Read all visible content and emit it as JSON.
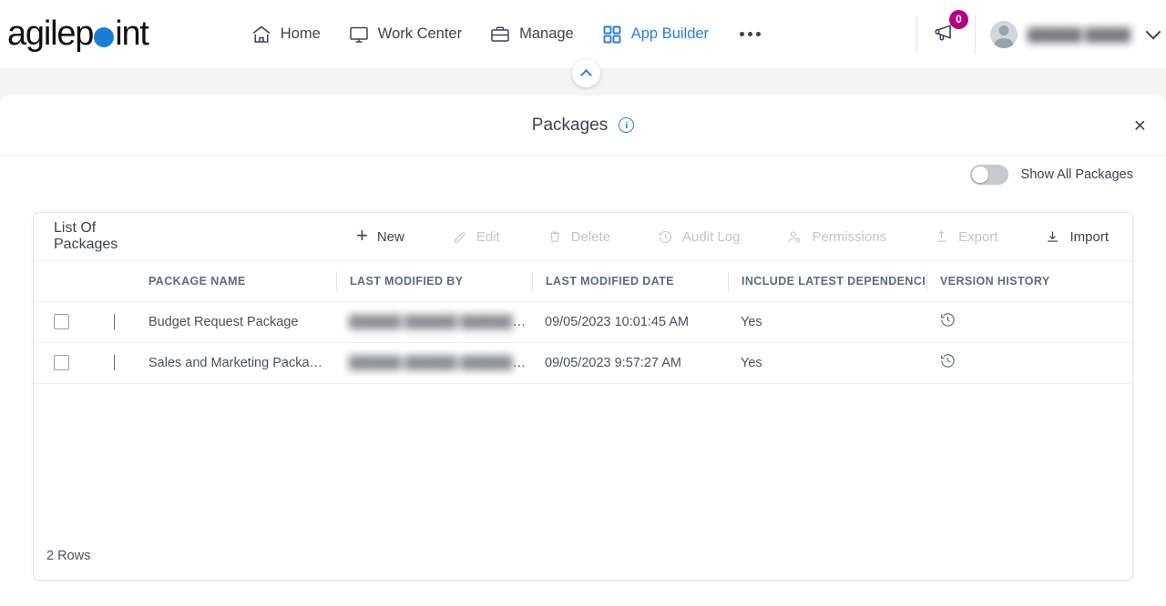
{
  "brand": {
    "name_part1": "agilep",
    "name_part2": "int",
    "dot_color": "#1a7fd4"
  },
  "topnav": {
    "items": [
      {
        "label": "Home",
        "icon": "home-icon",
        "active": false
      },
      {
        "label": "Work Center",
        "icon": "monitor-icon",
        "active": false
      },
      {
        "label": "Manage",
        "icon": "briefcase-icon",
        "active": false
      },
      {
        "label": "App Builder",
        "icon": "grid-icon",
        "active": true
      }
    ],
    "more_label": "",
    "announcement_badge": "0",
    "user_name": "██████ █████",
    "accent_color": "#2a7de1",
    "badge_color": "#b5007e"
  },
  "panel": {
    "title": "Packages",
    "info_icon": "info-icon",
    "close_label": "×",
    "collapse_icon": "chevron-up-icon"
  },
  "show_all": {
    "label": "Show All Packages",
    "checked": false
  },
  "card": {
    "heading": "List Of Packages",
    "toolbar": [
      {
        "label": "New",
        "icon": "plus-icon",
        "disabled": false
      },
      {
        "label": "Edit",
        "icon": "pencil-icon",
        "disabled": true
      },
      {
        "label": "Delete",
        "icon": "trash-icon",
        "disabled": true
      },
      {
        "label": "Audit Log",
        "icon": "history-icon",
        "disabled": true
      },
      {
        "label": "Permissions",
        "icon": "user-permissions-icon",
        "disabled": true
      },
      {
        "label": "Export",
        "icon": "upload-icon",
        "disabled": true
      },
      {
        "label": "Import",
        "icon": "download-icon",
        "disabled": false
      }
    ],
    "columns": [
      "PACKAGE NAME",
      "LAST MODIFIED BY",
      "LAST MODIFIED DATE",
      "INCLUDE LATEST DEPENDENCIES",
      "VERSION HISTORY"
    ],
    "rows": [
      {
        "package_name": "Budget Request Package",
        "last_modified_by": "██████ ██████ █████████",
        "last_modified_date": "09/05/2023 10:01:45 AM",
        "include_latest_dependencies": "Yes",
        "version_history": "history-icon",
        "selected": false
      },
      {
        "package_name": "Sales and Marketing Packa…",
        "last_modified_by": "██████ ██████ █████████",
        "last_modified_date": "09/05/2023 9:57:27 AM",
        "include_latest_dependencies": "Yes",
        "version_history": "history-icon",
        "selected": false
      }
    ],
    "row_count_label": "2 Rows"
  }
}
